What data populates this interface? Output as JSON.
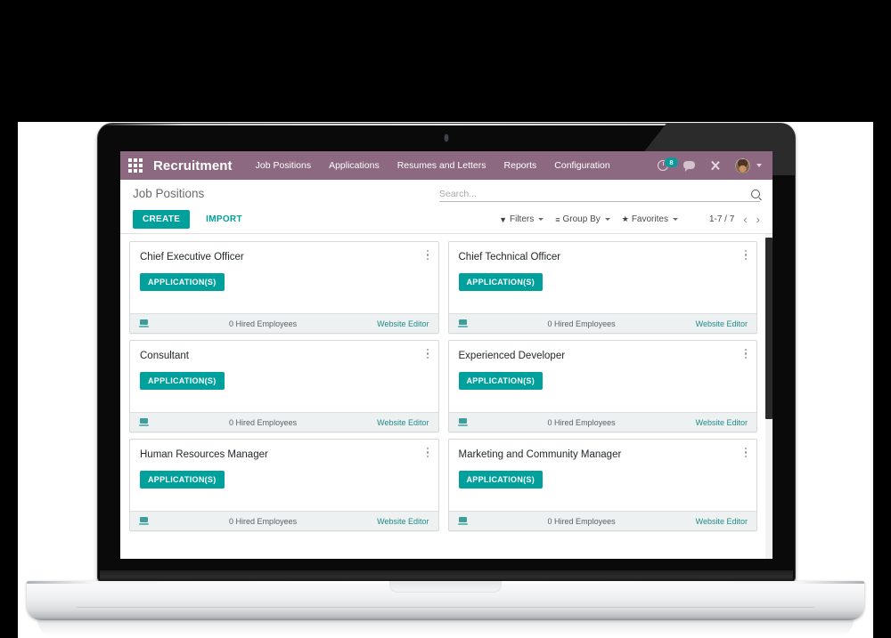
{
  "navbar": {
    "apps_icon": "apps-grid-icon",
    "brand": "Recruitment",
    "menu": [
      {
        "label": "Job Positions"
      },
      {
        "label": "Applications"
      },
      {
        "label": "Resumes and Letters"
      },
      {
        "label": "Reports"
      },
      {
        "label": "Configuration"
      }
    ],
    "right": {
      "activity_icon": "clock-icon",
      "activity_count": "8",
      "messages_icon": "chat-bubble-icon",
      "shortcuts_icon": "close-icon",
      "avatar_icon": "user-avatar",
      "caret_icon": "chevron-down-icon"
    },
    "colors": {
      "background": "#8d6881",
      "badge": "#00a09d"
    }
  },
  "control_panel": {
    "title": "Job Positions",
    "create_label": "CREATE",
    "import_label": "IMPORT",
    "search": {
      "value": "",
      "placeholder": "Search...",
      "icon": "search-icon"
    },
    "filters": [
      {
        "label": "Filters",
        "icon": "filter-icon",
        "glyph": "▼"
      },
      {
        "label": "Group By",
        "icon": "list-icon",
        "glyph": "≡"
      },
      {
        "label": "Favorites",
        "icon": "star-icon",
        "glyph": "★"
      }
    ],
    "pager": {
      "range": "1-7 / 7",
      "prev_icon": "chevron-left-icon",
      "prev_glyph": "‹",
      "next_icon": "chevron-right-icon",
      "next_glyph": "›"
    },
    "accent_color": "#00a09d"
  },
  "kanban": {
    "cards": [
      {
        "title": "Chief Executive Officer",
        "button_label": "APPLICATION(S)",
        "hired": "0 Hired Employees",
        "website_editor": "Website Editor",
        "menu_icon": "kebab-menu-icon",
        "footer_icon": "website-icon"
      },
      {
        "title": "Chief Technical Officer",
        "button_label": "APPLICATION(S)",
        "hired": "0 Hired Employees",
        "website_editor": "Website Editor",
        "menu_icon": "kebab-menu-icon",
        "footer_icon": "website-icon"
      },
      {
        "title": "Consultant",
        "button_label": "APPLICATION(S)",
        "hired": "0 Hired Employees",
        "website_editor": "Website Editor",
        "menu_icon": "kebab-menu-icon",
        "footer_icon": "website-icon"
      },
      {
        "title": "Experienced Developer",
        "button_label": "APPLICATION(S)",
        "hired": "0 Hired Employees",
        "website_editor": "Website Editor",
        "menu_icon": "kebab-menu-icon",
        "footer_icon": "website-icon"
      },
      {
        "title": "Human Resources Manager",
        "button_label": "APPLICATION(S)",
        "hired": "0 Hired Employees",
        "website_editor": "Website Editor",
        "menu_icon": "kebab-menu-icon",
        "footer_icon": "website-icon"
      },
      {
        "title": "Marketing and Community Manager",
        "button_label": "APPLICATION(S)",
        "hired": "0 Hired Employees",
        "website_editor": "Website Editor",
        "menu_icon": "kebab-menu-icon",
        "footer_icon": "website-icon"
      }
    ]
  },
  "device": {
    "camera_icon": "webcam-icon"
  }
}
